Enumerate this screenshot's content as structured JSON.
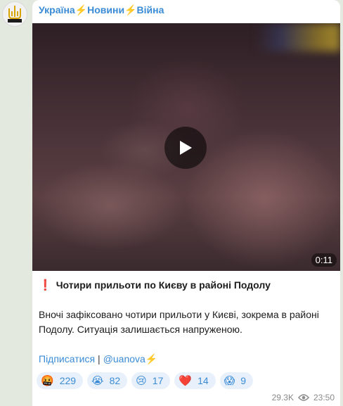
{
  "channel": {
    "name": "Україна⚡️Новини⚡️Війна",
    "avatar_icon": "trident-logo"
  },
  "video": {
    "duration": "0:11",
    "play_icon": "play-icon"
  },
  "post": {
    "headline_mark": "❗️",
    "headline": "Чотири прильоти по Києву в районі Подолу",
    "body": "Вночі зафіксовано чотири прильоти у Києві, зокрема в районі Подолу. Ситуація залишається напруженою.",
    "subscribe_link": "Підписатися",
    "separator": "|",
    "handle_link": "@uanova",
    "handle_bolt": "⚡️"
  },
  "reactions": [
    {
      "emoji": "🤬",
      "count": "229"
    },
    {
      "emoji": "😭",
      "count": "82"
    },
    {
      "emoji": "😢",
      "count": "17"
    },
    {
      "emoji": "❤️",
      "count": "14"
    },
    {
      "emoji": "😱",
      "count": "9"
    }
  ],
  "meta": {
    "views": "29.3K",
    "time": "23:50",
    "views_icon": "eye-icon"
  },
  "colors": {
    "link": "#3a8bd6",
    "reaction_bg": "#e8f1fb",
    "background": "#e3e9df"
  }
}
